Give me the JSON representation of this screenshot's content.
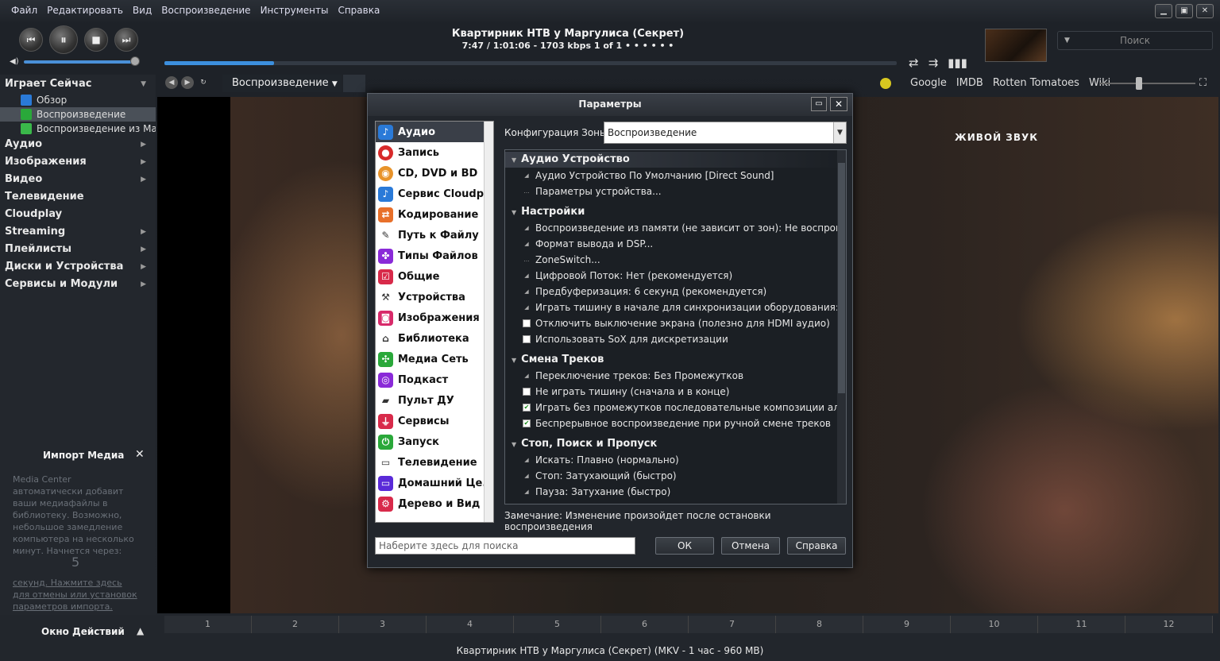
{
  "menu": [
    "Файл",
    "Редактировать",
    "Вид",
    "Воспроизведение",
    "Инструменты",
    "Справка"
  ],
  "now": {
    "title": "Квартирник НТВ у Маргулиса (Секрет)",
    "info": "7:47 / 1:01:06 - 1703 kbps  1 of 1  •  •  •  •  •  •",
    "progress": 0.15
  },
  "search_placeholder": "Поиск",
  "view_dropdown": "Воспроизведение",
  "weblinks": [
    "Google",
    "IMDB",
    "Rotten Tomatoes",
    "Wiki"
  ],
  "sidebar": {
    "now_playing": "Играет Сейчас",
    "subs": [
      "Обзор",
      "Воспроизведение",
      "Воспроизведение из Ма..."
    ],
    "sections": [
      "Аудио",
      "Изображения",
      "Видео",
      "Телевидение",
      "Cloudplay",
      "Streaming",
      "Плейлисты",
      "Диски и Устройства",
      "Сервисы и Модули"
    ]
  },
  "import": {
    "title": "Импорт Медиа",
    "text": "Media Center автоматически добавит ваши медиафайлы в библиотеку. Возможно, небольшое замедление компьютера на несколько минут. Начнется через:",
    "count": "5",
    "link": "секунд. Нажмите здесь для отмены или установок параметров импорта."
  },
  "actions": "Окно Действий",
  "video_overlay": "ЖИВОЙ ЗВУК",
  "chapters": [
    "1",
    "2",
    "3",
    "4",
    "5",
    "6",
    "7",
    "8",
    "9",
    "10",
    "11",
    "12"
  ],
  "status": "Квартирник НТВ у Маргулиса (Секрет) (MKV - 1 час - 960 MB)",
  "dialog": {
    "title": "Параметры",
    "categories": [
      "Аудио",
      "Запись",
      "CD, DVD и BD",
      "Сервис Cloudp...",
      "Кодирование",
      "Путь к Файлу",
      "Типы Файлов",
      "Общие",
      "Устройства",
      "Изображения",
      "Библиотека",
      "Медиа Сеть",
      "Подкаст",
      "Пульт ДУ",
      "Сервисы",
      "Запуск",
      "Телевидение",
      "Домашний Це...",
      "Дерево и Вид"
    ],
    "zone_label": "Конфигурация Зоны:",
    "zone_value": "Воспроизведение",
    "groups": [
      {
        "name": "Аудио Устройство",
        "rows": [
          "Аудио Устройство По Умолчанию [Direct Sound]",
          "Параметры устройства..."
        ]
      },
      {
        "name": "Настройки",
        "rows": [
          "Воспроизведение из памяти (не зависит от зон): Не воспроизвод...",
          "Формат вывода и DSP...",
          "ZoneSwitch...",
          "Цифровой Поток: Нет (рекомендуется)",
          "Предбуферизация: 6 секунд (рекомендуется)",
          "Играть тишину в начале для синхронизации оборудования: Нет",
          "Отключить выключение экрана (полезно для HDMI аудио)",
          "Использовать SoX для дискретизации"
        ]
      },
      {
        "name": "Смена Треков",
        "rows": [
          "Переключение треков: Без Промежутков",
          "Не играть тишину (сначала и в конце)",
          "Играть без промежутков последовательные композиции альбома",
          "Беспрерывное воспроизведение при ручной смене треков"
        ]
      },
      {
        "name": "Стоп, Поиск и Пропуск",
        "rows": [
          "Искать: Плавно (нормально)",
          "Стоп: Затухающий (быстро)",
          "Пауза: Затухание (быстро)"
        ]
      }
    ],
    "note": "Замечание: Изменение произойдет после остановки воспроизведения",
    "search_placeholder": "Наберите здесь для поиска",
    "ok": "ОК",
    "cancel": "Отмена",
    "help": "Справка"
  }
}
